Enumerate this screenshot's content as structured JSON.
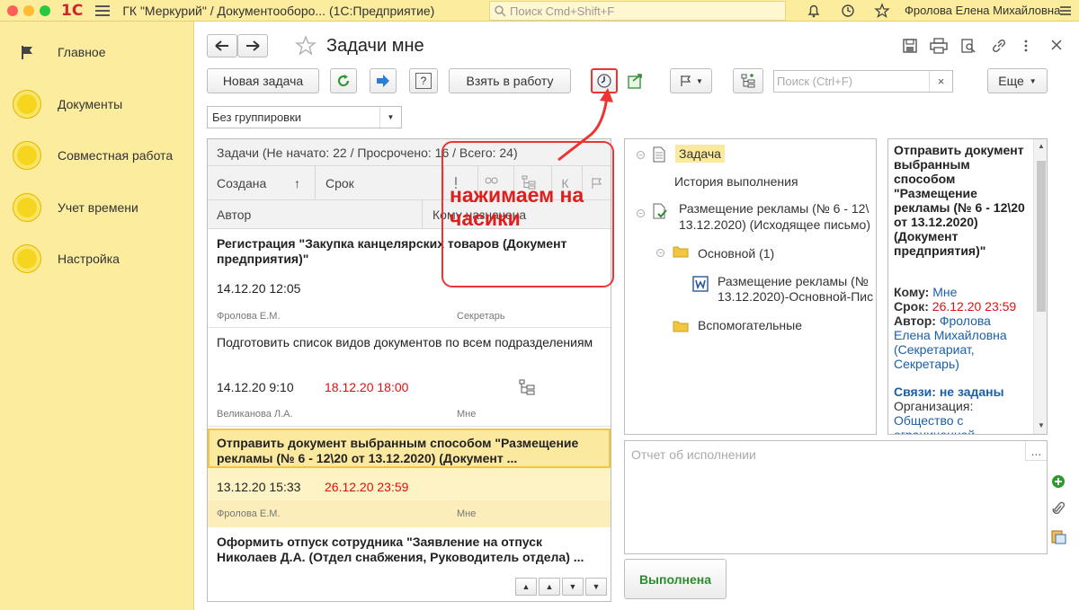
{
  "app": {
    "title": "ГК \"Меркурий\" / Документооборо...  (1С:Предприятие)",
    "search_placeholder": "Поиск Cmd+Shift+F",
    "user": "Фролова Елена Михайловна",
    "logo": "1С"
  },
  "sidebar": {
    "items": [
      {
        "label": "Главное",
        "icon": "flag-icon"
      },
      {
        "label": "Документы",
        "icon": "circle-icon"
      },
      {
        "label": "Совместная работа",
        "icon": "circle-icon"
      },
      {
        "label": "Учет времени",
        "icon": "circle-icon"
      },
      {
        "label": "Настройка",
        "icon": "circle-icon"
      }
    ]
  },
  "page": {
    "title": "Задачи мне",
    "toolbar": {
      "new_task": "Новая задача",
      "take_to_work": "Взять в работу",
      "search_placeholder": "Поиск (Ctrl+F)",
      "search_clear": "×",
      "more": "Еще",
      "help": "?"
    },
    "grouping": {
      "value": "Без группировки"
    }
  },
  "task_list": {
    "summary": "Задачи (Не начато: 22 / Просрочено: 16 / Всего: 24)",
    "columns": {
      "created": "Создана",
      "sort": "↑",
      "deadline": "Срок",
      "author": "Автор",
      "assigned": "Кому назначена",
      "flag_col": "К"
    },
    "tasks": [
      {
        "title": "Регистрация \"Закупка канцелярских товаров (Документ предприятия)\"",
        "created": "14.12.20 12:05",
        "deadline": "",
        "author": "Фролова Е.М.",
        "assignee": "Секретарь",
        "bold": true
      },
      {
        "title": "Подготовить список видов документов по всем подразделениям",
        "created": "14.12.20 9:10",
        "deadline": "18.12.20 18:00",
        "author": "Великанова Л.А.",
        "assignee": "Мне",
        "bold": false
      },
      {
        "title": "Отправить документ выбранным способом \"Размещение рекламы (№ 6 - 12\\20 от 13.12.2020) (Документ ...",
        "created": "13.12.20 15:33",
        "deadline": "26.12.20 23:59",
        "author": "Фролова Е.М.",
        "assignee": "Мне",
        "bold": true
      },
      {
        "title": "Оформить отпуск сотрудника \"Заявление на отпуск Николаев Д.А. (Отдел снабжения, Руководитель отдела) ...",
        "created": "",
        "deadline": "",
        "author": "",
        "assignee": "",
        "bold": true
      }
    ]
  },
  "annotation": {
    "text": "нажимаем на часики"
  },
  "tree": {
    "task": "Задача",
    "history": "История выполнения",
    "doc": "Размещение рекламы (№ 6 - 12\\",
    "doc2": "13.12.2020) (Исходящее письмо)",
    "folder_main": "Основной (1)",
    "file": "Размещение рекламы (№",
    "file2": "13.12.2020)-Основной-Пис",
    "folder_aux": "Вспомогательные"
  },
  "details": {
    "title": "Отправить документ выбранным способом \"Размещение рекламы (№ 6 - 12\\20 от 13.12.2020) (Документ предприятия)\"",
    "to_label": "Кому:",
    "to_value": "Мне",
    "deadline_label": "Срок:",
    "deadline_value": "26.12.20 23:59",
    "author_label": "Автор:",
    "author_value": "Фролова Елена Михайловна (Секретариат, Секретарь)",
    "links": "Связи: не заданы",
    "org_label": "Организация:",
    "org_value": "Общество с ограниченной"
  },
  "report": {
    "placeholder": "Отчет об исполнении",
    "more": "..."
  },
  "done_button": "Выполнена",
  "colors": {
    "sidebar": "#fbec9e",
    "accent_red": "#e01e1e",
    "selected_row": "#fdf3c4",
    "link": "#1b5fa8",
    "green": "#2e8b2e"
  }
}
